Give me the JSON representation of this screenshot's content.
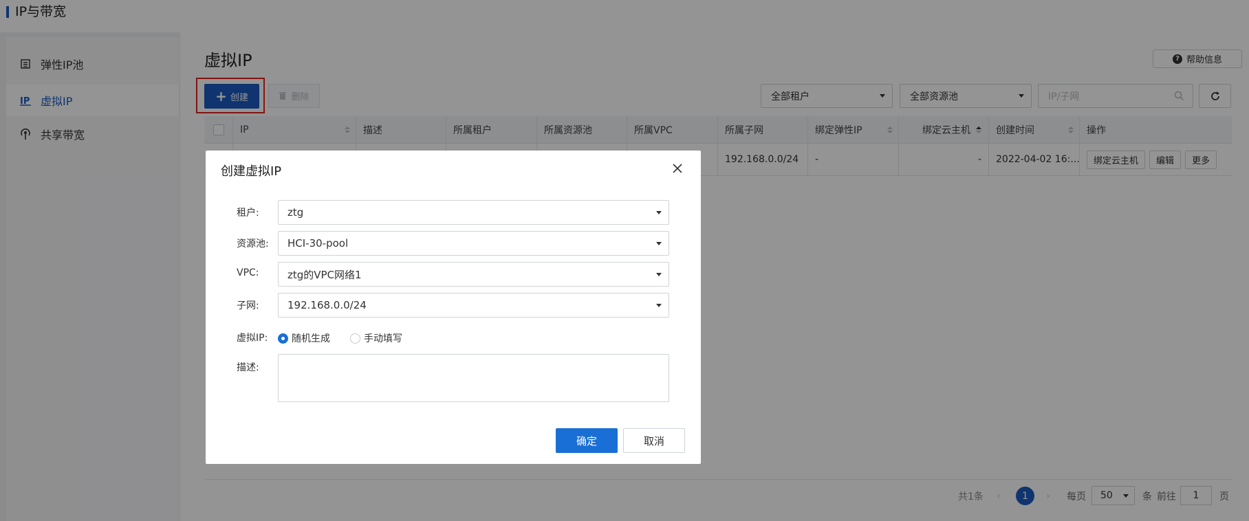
{
  "topbar": {
    "title": "IP与带宽"
  },
  "sidebar": {
    "items": [
      {
        "label": "弹性IP池",
        "icon": "list-icon",
        "active": false
      },
      {
        "label": "虚拟IP",
        "icon": "ip-icon",
        "active": true
      },
      {
        "label": "共享带宽",
        "icon": "broadcast-icon",
        "active": false
      }
    ]
  },
  "page": {
    "title": "虚拟IP",
    "help_label": "帮助信息"
  },
  "toolbar": {
    "create_label": "创建",
    "delete_label": "删除",
    "tenant_filter": "全部租户",
    "pool_filter": "全部资源池",
    "search_placeholder": "IP/子网"
  },
  "table": {
    "headers": [
      "IP",
      "描述",
      "所属租户",
      "所属资源池",
      "所属VPC",
      "所属子网",
      "绑定弹性IP",
      "绑定云主机",
      "创建时间",
      "操作"
    ],
    "rows": [
      {
        "subnet": "192.168.0.0/24",
        "eip": "-",
        "host": "-",
        "created": "2022-04-02 16:...",
        "ops": [
          "绑定云主机",
          "编辑",
          "更多"
        ]
      }
    ]
  },
  "pager": {
    "total": "共1条",
    "current_page": "1",
    "per_page_label": "每页",
    "page_size": "50",
    "unit": "条",
    "goto_label": "前往",
    "goto_value": "1",
    "page_unit": "页"
  },
  "modal": {
    "title": "创建虚拟IP",
    "fields": {
      "tenant_label": "租户:",
      "tenant_value": "ztg",
      "pool_label": "资源池:",
      "pool_value": "HCI-30-pool",
      "vpc_label": "VPC:",
      "vpc_value": "ztg的VPC网络1",
      "subnet_label": "子网:",
      "subnet_value": "192.168.0.0/24",
      "vip_label": "虚拟IP:",
      "vip_option_random": "随机生成",
      "vip_option_manual": "手动填写",
      "vip_selected": "随机生成",
      "desc_label": "描述:"
    },
    "ok_label": "确定",
    "cancel_label": "取消"
  },
  "colors": {
    "primary": "#1a5bbf",
    "highlight": "#e0241f",
    "overlay": "rgba(0,0,0,0.42)"
  }
}
